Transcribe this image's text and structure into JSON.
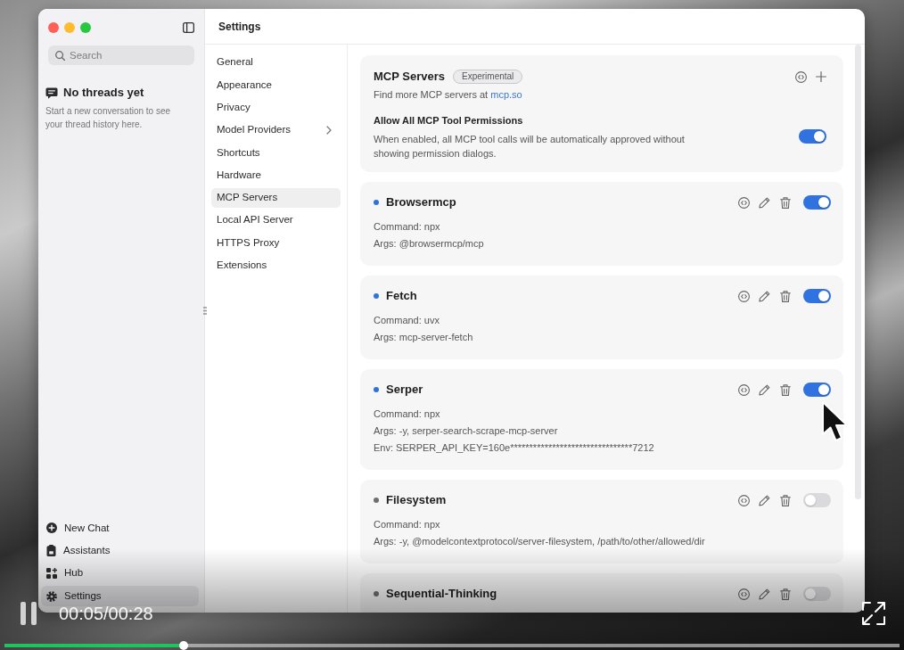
{
  "app_window": {
    "sidebar": {
      "search": {
        "placeholder": "Search"
      },
      "empty_state": {
        "title": "No threads yet",
        "text": "Start a new conversation to see your thread history here."
      },
      "nav_items": [
        {
          "label": "New Chat",
          "kind": "new-chat",
          "selected": false
        },
        {
          "label": "Assistants",
          "kind": "assistants",
          "selected": false
        },
        {
          "label": "Hub",
          "kind": "hub",
          "selected": false
        },
        {
          "label": "Settings",
          "kind": "settings",
          "selected": true
        }
      ]
    },
    "header": {
      "title": "Settings"
    },
    "settings_menu": [
      {
        "label": "General",
        "selected": false,
        "has_submenu": false
      },
      {
        "label": "Appearance",
        "selected": false,
        "has_submenu": false
      },
      {
        "label": "Privacy",
        "selected": false,
        "has_submenu": false
      },
      {
        "label": "Model Providers",
        "selected": false,
        "has_submenu": true
      },
      {
        "label": "Shortcuts",
        "selected": false,
        "has_submenu": false
      },
      {
        "label": "Hardware",
        "selected": false,
        "has_submenu": false
      },
      {
        "label": "MCP Servers",
        "selected": true,
        "has_submenu": false
      },
      {
        "label": "Local API Server",
        "selected": false,
        "has_submenu": false
      },
      {
        "label": "HTTPS Proxy",
        "selected": false,
        "has_submenu": false
      },
      {
        "label": "Extensions",
        "selected": false,
        "has_submenu": false
      }
    ],
    "mcp_panel": {
      "title": "MCP Servers",
      "badge": "Experimental",
      "subtitle": "Find more MCP servers at",
      "link": "mcp.so",
      "permission": {
        "title": "Allow All MCP Tool Permissions",
        "description": "When enabled, all MCP tool calls will be automatically approved without showing permission dialogs.",
        "on": true
      }
    },
    "servers": [
      {
        "name": "Browsermcp",
        "color": "#2f72d8",
        "on": true,
        "details": [
          "Command: npx",
          "Args: @browsermcp/mcp"
        ]
      },
      {
        "name": "Fetch",
        "color": "#2f72d8",
        "on": true,
        "details": [
          "Command: uvx",
          "Args: mcp-server-fetch"
        ]
      },
      {
        "name": "Serper",
        "color": "#2f72d8",
        "on": true,
        "details": [
          "Command: npx",
          "Args: -y, serper-search-scrape-mcp-server",
          "Env: SERPER_API_KEY=160e********************************7212"
        ]
      },
      {
        "name": "Filesystem",
        "color": "#6e6e6e",
        "on": false,
        "details": [
          "Command: npx",
          "Args: -y, @modelcontextprotocol/server-filesystem, /path/to/other/allowed/dir"
        ]
      },
      {
        "name": "Sequential-Thinking",
        "color": "#6e6e6e",
        "on": false
      }
    ]
  },
  "video_player": {
    "playing": true,
    "time": "00:05/00:28",
    "level": 0.2
  }
}
